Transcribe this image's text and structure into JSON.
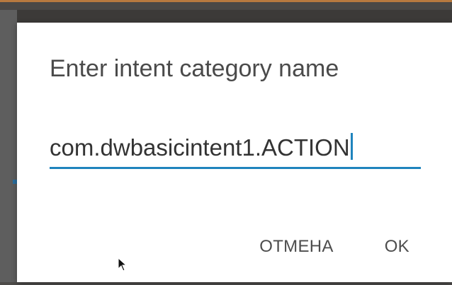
{
  "dialog": {
    "title": "Enter intent category name",
    "input_value": "com.dwbasicintent1.ACTION",
    "buttons": {
      "cancel": "ОТМЕНА",
      "ok": "OK"
    }
  },
  "colors": {
    "accent": "#1f84bd",
    "dialog_background": "#ffffff",
    "overlay": "#3c3a38"
  },
  "icons": {
    "cursor": "mouse-pointer-icon"
  }
}
